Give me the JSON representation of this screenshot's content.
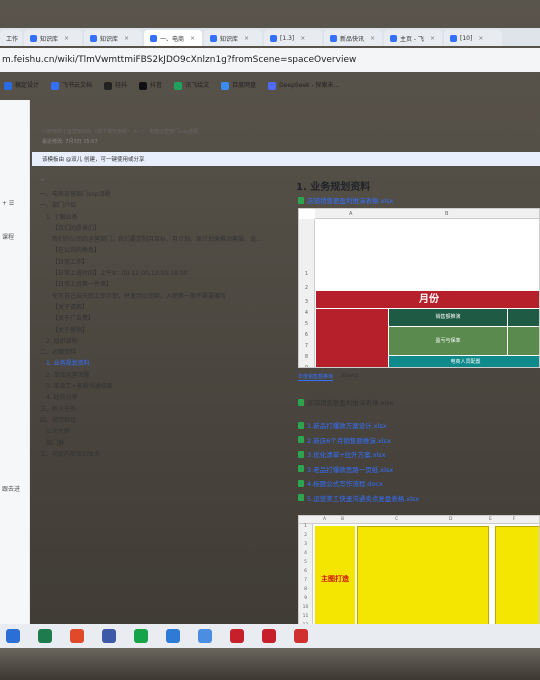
{
  "tabs": [
    {
      "label": "工作"
    },
    {
      "label": "知识库"
    },
    {
      "label": "知识库"
    },
    {
      "label": "一、电商"
    },
    {
      "label": "知识库"
    },
    {
      "label": "[1.3]"
    },
    {
      "label": "新品快讯"
    },
    {
      "label": "主页 - 飞"
    },
    {
      "label": "[10]"
    }
  ],
  "url": "m.feishu.cn/wiki/TlmVwmttmiFBS2kJDO9cXnlzn1g?fromScene=spaceOverview",
  "bookmarks": [
    {
      "label": "稿定设计",
      "color": "#2b6be5"
    },
    {
      "label": "飞书云文档",
      "color": "#3370ff"
    },
    {
      "label": "轻抖",
      "color": "#222222"
    },
    {
      "label": "抖音",
      "color": "#111111"
    },
    {
      "label": "讯飞绘文",
      "color": "#1fa05b"
    },
    {
      "label": "百度网盘",
      "color": "#3b8bf5"
    },
    {
      "label": "DeepSeek - 探索未...",
      "color": "#4d6bfe"
    }
  ],
  "left_strip": {
    "item1": "+ ☰",
    "item2": "课程",
    "item3": "跟去进"
  },
  "breadcrumbs": "六欧电商  |  运营知识库（线下课专用版）  >  一、电商运营部门sop流程",
  "meta": "最近修改: 7月3日 15:07",
  "notice": "该模板由 @双儿 创建，可一键使用或分享",
  "toc_collapse": "«",
  "toc": [
    {
      "label": "一、电商运营部门sop流程",
      "level": 1,
      "active": false
    },
    {
      "label": "一、部门介绍",
      "level": 1,
      "active": false
    },
    {
      "label": "1. 了解业务",
      "level": 2,
      "active": false
    },
    {
      "label": "【我们的愿景们】",
      "level": 3,
      "active": false
    },
    {
      "label": "我们的公司的运营部门，我们要定制月目标、月计划、周计划来推动客服、设...",
      "level": 3,
      "active": false
    },
    {
      "label": "【在公司的角色】",
      "level": 3,
      "active": false
    },
    {
      "label": "【日常工作】",
      "level": 3,
      "active": false
    },
    {
      "label": "【日常上班时间】上午9：00-12:00,13:00-18:00",
      "level": 3,
      "active": false
    },
    {
      "label": "【日常上班第一件事】",
      "level": 3,
      "active": false
    },
    {
      "label": "先写自己当天的工作计划，并发到公司群，入职第一周不需要编写",
      "level": 3,
      "active": false
    },
    {
      "label": "【关于请假】",
      "level": 3,
      "active": false
    },
    {
      "label": "【关于广告费】",
      "level": 3,
      "active": false
    },
    {
      "label": "【关于报销】",
      "level": 3,
      "active": false
    },
    {
      "label": "2. 组织架构",
      "level": 2,
      "active": false
    },
    {
      "label": "二、必做资料",
      "level": 1,
      "active": false
    },
    {
      "label": "1. 业务规划资料",
      "level": 2,
      "active": true
    },
    {
      "label": "2. 单品运营流程",
      "level": 2,
      "active": false
    },
    {
      "label": "3. 单美工+客服沟通结果",
      "level": 2,
      "active": false
    },
    {
      "label": "4. 经验分享",
      "level": 2,
      "active": false
    },
    {
      "label": "三、新人任务",
      "level": 1,
      "active": false
    },
    {
      "label": "四、常用群组",
      "level": 1,
      "active": false
    },
    {
      "label": "公司大群",
      "level": 2,
      "active": false
    },
    {
      "label": "部门群",
      "level": 2,
      "active": false
    },
    {
      "label": "五、电商内部培训体系",
      "level": 1,
      "active": false
    }
  ],
  "content": {
    "heading": "1. 业务规划资料",
    "file_top": "店铺销售额盈利推演表格.xlsx",
    "sheet_cols": [
      "A",
      "B"
    ],
    "sheet_rows": [
      "1",
      "2",
      "3",
      "4",
      "5",
      "6",
      "7",
      "8",
      "9",
      "10",
      "11"
    ],
    "sheet_title": "月份",
    "cell_sales_label": "销售额推演",
    "cell_breakeven": "盈亏与保率",
    "cell_staff": "电商人员配置",
    "sheet_tabs": [
      "年度销售额推演",
      "Sheet2"
    ],
    "file_attach": "店铺销售额盈利推演表格.xlsx",
    "file_list": [
      "1.新品打爆款方案设计.xlsx",
      "2.新店6个月销售额推演.xlsx",
      "3.优化清单+拉升方案.xlsx",
      "3.老品打爆款思路一页纸.xlsx",
      "4.标题公式写作流程.docx",
      "5.运营美工快速沟通卖点复盘表格.xlsx"
    ],
    "sheet2_cols": [
      "A",
      "B",
      "C",
      "D",
      "E",
      "F"
    ],
    "sheet2_rows": [
      "1",
      "2",
      "3",
      "4",
      "5",
      "6",
      "7",
      "8",
      "9",
      "10",
      "11",
      "12"
    ],
    "sheet2_label": "主图打造"
  },
  "colors": {
    "accent": "#3370ff",
    "sheet_red": "#b5202a",
    "sheet_darkgreen": "#1e5a44",
    "sheet_green": "#5b8a4e",
    "sheet_teal": "#0f8a8a",
    "sheet_yellow": "#f5e600"
  }
}
